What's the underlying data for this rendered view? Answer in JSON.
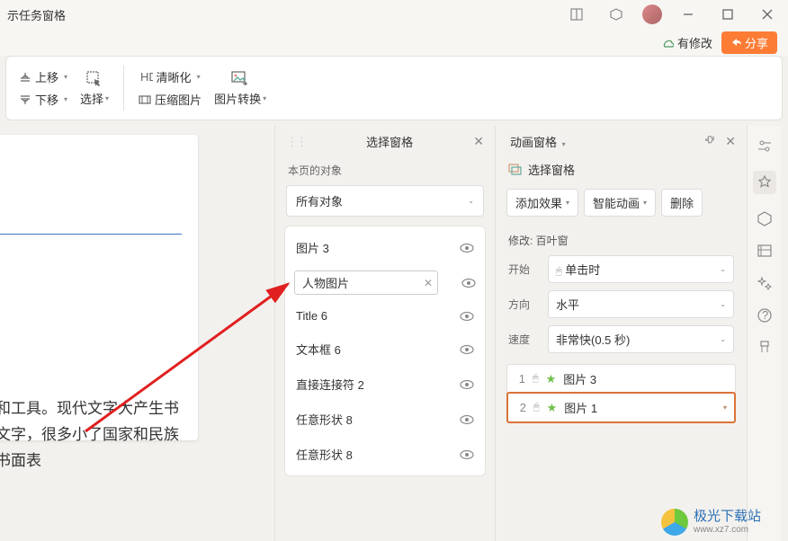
{
  "titlebar": {
    "task_pane_label": "示任务窗格"
  },
  "sharebar": {
    "has_changes": "有修改",
    "share": "分享"
  },
  "ribbon": {
    "move_up": "上移",
    "move_down": "下移",
    "select": "选择",
    "clarity": "清晰化",
    "compress": "压缩图片",
    "convert": "图片转换"
  },
  "selection_pane": {
    "title": "选择窗格",
    "subtitle": "本页的对象",
    "filter": "所有对象",
    "editing_value": "人物图片",
    "items": [
      {
        "label": "图片 3"
      },
      {
        "label": "人物图片"
      },
      {
        "label": "Title 6"
      },
      {
        "label": "文本框 6"
      },
      {
        "label": "直接连接符 2"
      },
      {
        "label": "任意形状 8"
      },
      {
        "label": "任意形状 8"
      }
    ]
  },
  "anim_pane": {
    "title": "动画窗格",
    "sel_pane_link": "选择窗格",
    "add_effect": "添加效果",
    "smart_anim": "智能动画",
    "delete": "删除",
    "modify_label": "修改: 百叶窗",
    "start_label": "开始",
    "start_value": "单击时",
    "dir_label": "方向",
    "dir_value": "水平",
    "speed_label": "速度",
    "speed_value": "非常快(0.5 秒)",
    "rows": [
      {
        "num": "1",
        "label": "图片 3"
      },
      {
        "num": "2",
        "label": "图片 1"
      }
    ]
  },
  "slide": {
    "text": "式和工具。现代文字大产生书面文字，很多小了国家和民族的书面表"
  },
  "watermark": {
    "name": "极光下载站",
    "url": "www.xz7.com"
  }
}
